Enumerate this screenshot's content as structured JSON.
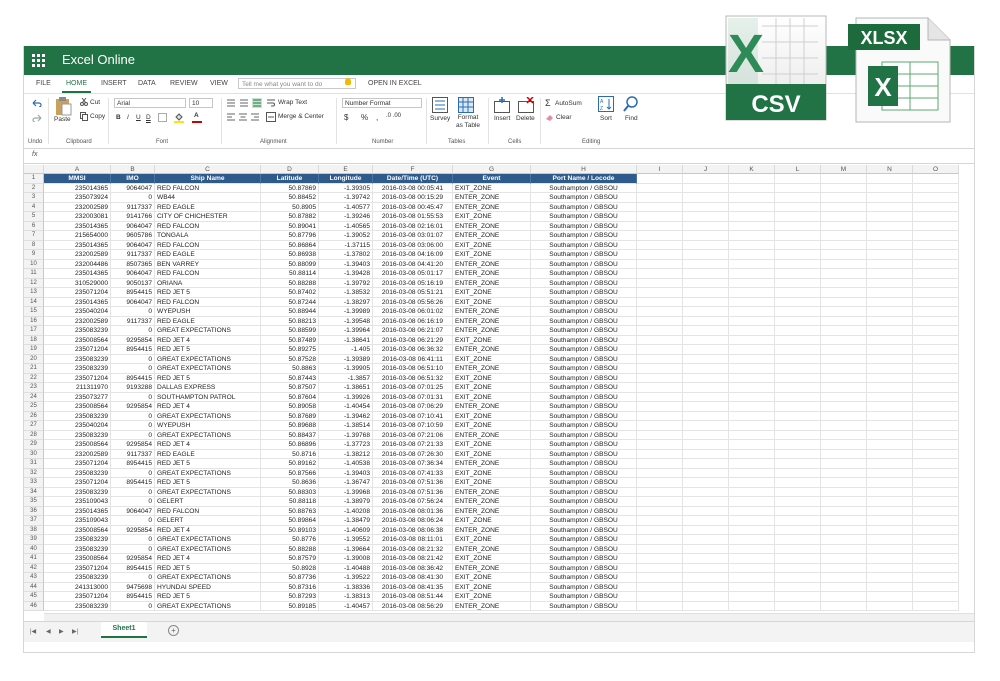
{
  "app": {
    "title": "Excel Online"
  },
  "menu": {
    "tabs": [
      "FILE",
      "HOME",
      "INSERT",
      "DATA",
      "REVIEW",
      "VIEW"
    ],
    "active_tab": "HOME",
    "tell_me_placeholder": "Tell me what you want to do",
    "open_in_excel": "OPEN IN EXCEL"
  },
  "ribbon": {
    "undo_label": "Undo",
    "paste_label": "Paste",
    "cut_label": "Cut",
    "copy_label": "Copy",
    "clipboard_label": "Clipboard",
    "font_name": "Arial",
    "font_size": "10",
    "font_label": "Font",
    "wrap_text": "Wrap Text",
    "merge_center": "Merge & Center",
    "alignment_label": "Alignment",
    "number_format": "Number Format",
    "number_label": "Number",
    "survey_label": "Survey",
    "format_as_table_label": "Format as Table",
    "tables_label": "Tables",
    "insert_label": "Insert",
    "delete_label": "Delete",
    "cells_label": "Cells",
    "autosum_label": "AutoSum",
    "clear_label": "Clear",
    "sort_label": "Sort",
    "find_label": "Find",
    "editing_label": "Editing",
    "currency_symbol": "$",
    "percent_symbol": "%",
    "comma_symbol": ","
  },
  "formula_bar": {
    "fx": "fx",
    "value": ""
  },
  "columns": [
    "A",
    "B",
    "C",
    "D",
    "E",
    "F",
    "G",
    "H",
    "I",
    "J",
    "K",
    "L",
    "M",
    "N",
    "O"
  ],
  "table": {
    "headers": [
      "MMSI",
      "IMO",
      "Ship Name",
      "Latitude",
      "Longitude",
      "Date/Time (UTC)",
      "Event",
      "Port Name / Locode"
    ],
    "rows": [
      [
        "235014365",
        "9064047",
        "RED FALCON",
        "50.87869",
        "-1.39305",
        "2016-03-08 00:05:41",
        "EXIT_ZONE",
        "Southampton / GBSOU"
      ],
      [
        "235073924",
        "0",
        "WB44",
        "50.88452",
        "-1.39742",
        "2016-03-08 00:15:29",
        "ENTER_ZONE",
        "Southampton / GBSOU"
      ],
      [
        "232002589",
        "9117337",
        "RED EAGLE",
        "50.8905",
        "-1.40577",
        "2016-03-08 00:45:47",
        "ENTER_ZONE",
        "Southampton / GBSOU"
      ],
      [
        "232003081",
        "9141766",
        "CITY OF CHICHESTER",
        "50.87882",
        "-1.39246",
        "2016-03-08 01:55:53",
        "EXIT_ZONE",
        "Southampton / GBSOU"
      ],
      [
        "235014365",
        "9064047",
        "RED FALCON",
        "50.89041",
        "-1.40565",
        "2016-03-08 02:16:01",
        "ENTER_ZONE",
        "Southampton / GBSOU"
      ],
      [
        "215654000",
        "9605786",
        "TONGALA",
        "50.87796",
        "-1.39052",
        "2016-03-08 03:01:07",
        "ENTER_ZONE",
        "Southampton / GBSOU"
      ],
      [
        "235014365",
        "9064047",
        "RED FALCON",
        "50.86864",
        "-1.37115",
        "2016-03-08 03:06:00",
        "EXIT_ZONE",
        "Southampton / GBSOU"
      ],
      [
        "232002589",
        "9117337",
        "RED EAGLE",
        "50.86938",
        "-1.37802",
        "2016-03-08 04:16:09",
        "EXIT_ZONE",
        "Southampton / GBSOU"
      ],
      [
        "232004486",
        "8507365",
        "BEN VARREY",
        "50.88099",
        "-1.39403",
        "2016-03-08 04:41:20",
        "ENTER_ZONE",
        "Southampton / GBSOU"
      ],
      [
        "235014365",
        "9064047",
        "RED FALCON",
        "50.88114",
        "-1.39428",
        "2016-03-08 05:01:17",
        "ENTER_ZONE",
        "Southampton / GBSOU"
      ],
      [
        "310529000",
        "9050137",
        "ORIANA",
        "50.88288",
        "-1.39792",
        "2016-03-08 05:16:19",
        "ENTER_ZONE",
        "Southampton / GBSOU"
      ],
      [
        "235071204",
        "8954415",
        "RED JET 5",
        "50.87402",
        "-1.38532",
        "2016-03-08 05:51:21",
        "EXIT_ZONE",
        "Southampton / GBSOU"
      ],
      [
        "235014365",
        "9064047",
        "RED FALCON",
        "50.87244",
        "-1.38297",
        "2016-03-08 05:56:26",
        "EXIT_ZONE",
        "Southampton / GBSOU"
      ],
      [
        "235040204",
        "0",
        "WYEPUSH",
        "50.88944",
        "-1.39989",
        "2016-03-08 06:01:02",
        "ENTER_ZONE",
        "Southampton / GBSOU"
      ],
      [
        "232002589",
        "9117337",
        "RED EAGLE",
        "50.88213",
        "-1.39548",
        "2016-03-08 06:16:19",
        "ENTER_ZONE",
        "Southampton / GBSOU"
      ],
      [
        "235083239",
        "0",
        "GREAT EXPECTATIONS",
        "50.88599",
        "-1.39964",
        "2016-03-08 06:21:07",
        "ENTER_ZONE",
        "Southampton / GBSOU"
      ],
      [
        "235008564",
        "9295854",
        "RED JET 4",
        "50.87489",
        "-1.38641",
        "2016-03-08 06:21:29",
        "EXIT_ZONE",
        "Southampton / GBSOU"
      ],
      [
        "235071204",
        "8954415",
        "RED JET 5",
        "50.89275",
        "-1.405",
        "2016-03-08 06:36:32",
        "ENTER_ZONE",
        "Southampton / GBSOU"
      ],
      [
        "235083239",
        "0",
        "GREAT EXPECTATIONS",
        "50.87528",
        "-1.39389",
        "2016-03-08 06:41:11",
        "EXIT_ZONE",
        "Southampton / GBSOU"
      ],
      [
        "235083239",
        "0",
        "GREAT EXPECTATIONS",
        "50.8863",
        "-1.39905",
        "2016-03-08 06:51:10",
        "ENTER_ZONE",
        "Southampton / GBSOU"
      ],
      [
        "235071204",
        "8954415",
        "RED JET 5",
        "50.87443",
        "-1.3857",
        "2016-03-08 06:51:32",
        "EXIT_ZONE",
        "Southampton / GBSOU"
      ],
      [
        "211311970",
        "9193288",
        "DALLAS EXPRESS",
        "50.87507",
        "-1.38651",
        "2016-03-08 07:01:25",
        "EXIT_ZONE",
        "Southampton / GBSOU"
      ],
      [
        "235073277",
        "0",
        "SOUTHAMPTON PATROL",
        "50.87604",
        "-1.39926",
        "2016-03-08 07:01:31",
        "EXIT_ZONE",
        "Southampton / GBSOU"
      ],
      [
        "235008564",
        "9295854",
        "RED JET 4",
        "50.89058",
        "-1.40454",
        "2016-03-08 07:06:29",
        "ENTER_ZONE",
        "Southampton / GBSOU"
      ],
      [
        "235083239",
        "0",
        "GREAT EXPECTATIONS",
        "50.87689",
        "-1.39462",
        "2016-03-08 07:10:41",
        "EXIT_ZONE",
        "Southampton / GBSOU"
      ],
      [
        "235040204",
        "0",
        "WYEPUSH",
        "50.89688",
        "-1.38514",
        "2016-03-08 07:10:59",
        "EXIT_ZONE",
        "Southampton / GBSOU"
      ],
      [
        "235083239",
        "0",
        "GREAT EXPECTATIONS",
        "50.88437",
        "-1.39768",
        "2016-03-08 07:21:06",
        "ENTER_ZONE",
        "Southampton / GBSOU"
      ],
      [
        "235008564",
        "9295854",
        "RED JET 4",
        "50.86896",
        "-1.37723",
        "2016-03-08 07:21:33",
        "EXIT_ZONE",
        "Southampton / GBSOU"
      ],
      [
        "232002589",
        "9117337",
        "RED EAGLE",
        "50.8716",
        "-1.38212",
        "2016-03-08 07:26:30",
        "EXIT_ZONE",
        "Southampton / GBSOU"
      ],
      [
        "235071204",
        "8954415",
        "RED JET 5",
        "50.89162",
        "-1.40538",
        "2016-03-08 07:36:34",
        "ENTER_ZONE",
        "Southampton / GBSOU"
      ],
      [
        "235083239",
        "0",
        "GREAT EXPECTATIONS",
        "50.87566",
        "-1.39403",
        "2016-03-08 07:41:33",
        "EXIT_ZONE",
        "Southampton / GBSOU"
      ],
      [
        "235071204",
        "8954415",
        "RED JET 5",
        "50.8636",
        "-1.36747",
        "2016-03-08 07:51:36",
        "EXIT_ZONE",
        "Southampton / GBSOU"
      ],
      [
        "235083239",
        "0",
        "GREAT EXPECTATIONS",
        "50.88303",
        "-1.39968",
        "2016-03-08 07:51:36",
        "ENTER_ZONE",
        "Southampton / GBSOU"
      ],
      [
        "235109043",
        "0",
        "GELERT",
        "50.88118",
        "-1.38979",
        "2016-03-08 07:56:24",
        "ENTER_ZONE",
        "Southampton / GBSOU"
      ],
      [
        "235014365",
        "9064047",
        "RED FALCON",
        "50.88763",
        "-1.40208",
        "2016-03-08 08:01:36",
        "ENTER_ZONE",
        "Southampton / GBSOU"
      ],
      [
        "235109043",
        "0",
        "GELERT",
        "50.89864",
        "-1.38479",
        "2016-03-08 08:06:24",
        "EXIT_ZONE",
        "Southampton / GBSOU"
      ],
      [
        "235008564",
        "9295854",
        "RED JET 4",
        "50.89103",
        "-1.40609",
        "2016-03-08 08:06:38",
        "ENTER_ZONE",
        "Southampton / GBSOU"
      ],
      [
        "235083239",
        "0",
        "GREAT EXPECTATIONS",
        "50.8776",
        "-1.39552",
        "2016-03-08 08:11:01",
        "EXIT_ZONE",
        "Southampton / GBSOU"
      ],
      [
        "235083239",
        "0",
        "GREAT EXPECTATIONS",
        "50.88288",
        "-1.39664",
        "2016-03-08 08:21:32",
        "ENTER_ZONE",
        "Southampton / GBSOU"
      ],
      [
        "235008564",
        "9295854",
        "RED JET 4",
        "50.87579",
        "-1.39008",
        "2016-03-08 08:21:42",
        "EXIT_ZONE",
        "Southampton / GBSOU"
      ],
      [
        "235071204",
        "8954415",
        "RED JET 5",
        "50.8928",
        "-1.40488",
        "2016-03-08 08:36:42",
        "ENTER_ZONE",
        "Southampton / GBSOU"
      ],
      [
        "235083239",
        "0",
        "GREAT EXPECTATIONS",
        "50.87736",
        "-1.39522",
        "2016-03-08 08:41:30",
        "EXIT_ZONE",
        "Southampton / GBSOU"
      ],
      [
        "241313000",
        "9475698",
        "HYUNDAI SPEED",
        "50.87316",
        "-1.38336",
        "2016-03-08 08:41:35",
        "EXIT_ZONE",
        "Southampton / GBSOU"
      ],
      [
        "235071204",
        "8954415",
        "RED JET 5",
        "50.87293",
        "-1.38313",
        "2016-03-08 08:51:44",
        "EXIT_ZONE",
        "Southampton / GBSOU"
      ],
      [
        "235083239",
        "0",
        "GREAT EXPECTATIONS",
        "50.89185",
        "-1.40457",
        "2016-03-08 08:56:29",
        "ENTER_ZONE",
        "Southampton / GBSOU"
      ]
    ]
  },
  "sheet": {
    "name": "Sheet1",
    "add_label": "+"
  },
  "file_icons": {
    "csv_label": "CSV",
    "xlsx_label": "XLSX",
    "colors": {
      "green": "#217346",
      "dark_green": "#1d6b3d",
      "light_green": "#5aaa6e"
    }
  },
  "colors": {
    "titlebar": "#217346",
    "header_fill": "#2e5a8c",
    "accent": "#217346"
  }
}
